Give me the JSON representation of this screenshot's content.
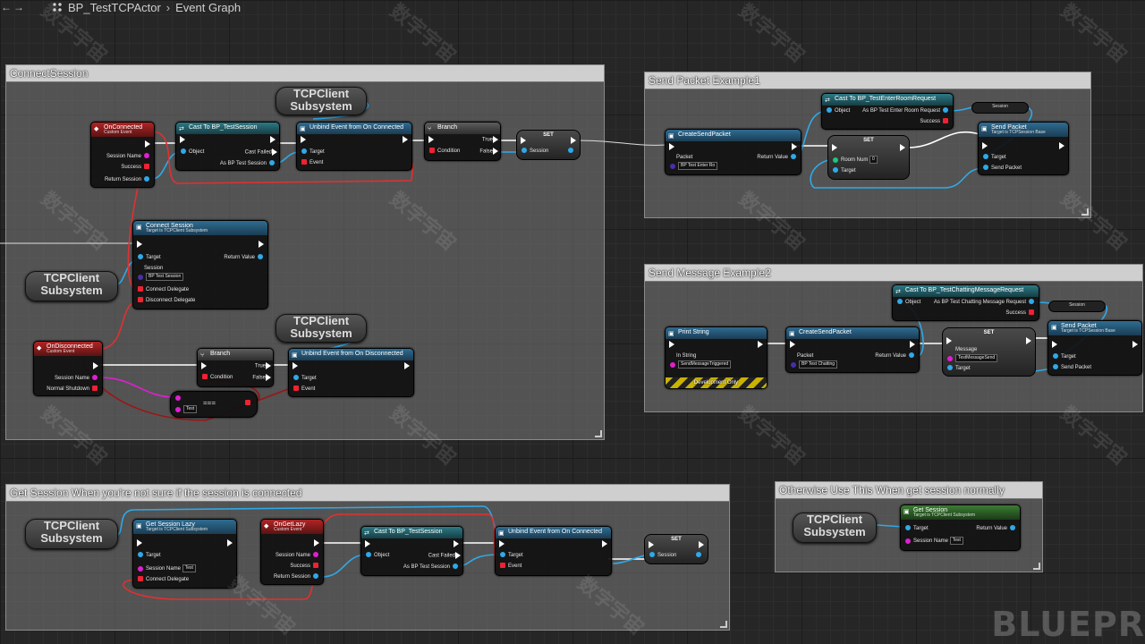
{
  "breadcrumb": {
    "asset": "BP_TestTCPActor",
    "graph": "Event Graph"
  },
  "brand_watermark": "BLUEPR",
  "watermark_text": "数字宇宙",
  "comments": {
    "connect_session": "ConnectSession",
    "send_packet": "Send Packet Example1",
    "send_message": "Send Message Example2",
    "get_session_lazy": "Get Session When you're not sure if the session is connected",
    "get_session_normal": "Otherwise Use This When get session normally"
  },
  "getter_label": "TCPClient\nSubsystem",
  "nodes": {
    "on_connected": {
      "title": "OnConnected",
      "sub": "Custom Event",
      "pins": [
        "Session Name",
        "Success",
        "Return Session"
      ]
    },
    "cast_session": {
      "title": "Cast To BP_TestSession",
      "object": "Object",
      "failed": "Cast Failed",
      "as": "As BP Test Session"
    },
    "unbind_connected": {
      "title": "Unbind Event from On Connected",
      "target": "Target",
      "event": "Event"
    },
    "branch": {
      "title": "Branch",
      "condition": "Condition",
      "true": "True",
      "false": "False"
    },
    "set": {
      "title": "SET",
      "session": "Session"
    },
    "connect_session": {
      "title": "Connect Session",
      "sub": "Target is TCPClient Subsystem",
      "target": "Target",
      "session": "Session",
      "session_value": "BP Test Session",
      "return": "Return Value",
      "connect_delegate": "Connect Delegate",
      "disconnect_delegate": "Disconnect Delegate"
    },
    "on_disconnected": {
      "title": "OnDisconnected",
      "sub": "Custom Event",
      "pins": [
        "Session Name",
        "Normal Shutdown"
      ]
    },
    "unbind_disconnected": {
      "title": "Unbind Event from On Disconnected"
    },
    "equal": {
      "op": "===",
      "value": "Test"
    },
    "create_packet1": {
      "title": "CreateSendPacket",
      "packet": "Packet",
      "packet_value": "BP Test Enter Ro",
      "return": "Return Value"
    },
    "cast_enter_room": {
      "title": "Cast To BP_TestEnterRoomRequest",
      "object": "Object",
      "as": "As BP Test Enter Room Request",
      "success": "Success"
    },
    "set_room": {
      "title": "SET",
      "room_num": "Room Num",
      "room_value": "0",
      "target": "Target"
    },
    "send_packet": {
      "title": "Send Packet",
      "sub": "Target is TCPSession Base",
      "target": "Target",
      "packet": "Send Packet"
    },
    "session_reroute": "Session",
    "print_string": {
      "title": "Print String",
      "in_string": "In String",
      "value": "SendMessageTriggered",
      "dev": "Development Only"
    },
    "create_packet2": {
      "title": "CreateSendPacket",
      "packet": "Packet",
      "packet_value": "BP Test Chatting",
      "return": "Return Value"
    },
    "cast_chatting": {
      "title": "Cast To BP_TestChattingMessageRequest",
      "object": "Object",
      "as": "As BP Test Chatting Message Request",
      "success": "Success"
    },
    "set_message": {
      "title": "SET",
      "message": "Message",
      "message_value": "TestMessageSend",
      "target": "Target"
    },
    "send_packet2": {
      "title": "Send Packet",
      "sub": "Target is TCPSession Base",
      "target": "Target",
      "packet": "Send Packet"
    },
    "get_session_lazy": {
      "title": "Get Session Lazy",
      "sub": "Target is TCPClient Subsystem",
      "target": "Target",
      "session_name": "Session Name",
      "session_value": "Test",
      "connect_delegate": "Connect Delegate"
    },
    "on_get_lazy": {
      "title": "OnGetLazy",
      "sub": "Custom Event",
      "pins": [
        "Session Name",
        "Success",
        "Return Session"
      ]
    },
    "get_session": {
      "title": "Get Session",
      "sub": "Target is TCPClient Subsystem",
      "target": "Target",
      "session_name": "Session Name",
      "session_value": "Test",
      "return": "Return Value"
    }
  },
  "colors": {
    "exec": "#ffffff",
    "object_wire": "#2fa9e8",
    "delegate_wire": "#e23030",
    "string_wire": "#e01fd1",
    "bool_wire": "#9c0f0f"
  }
}
